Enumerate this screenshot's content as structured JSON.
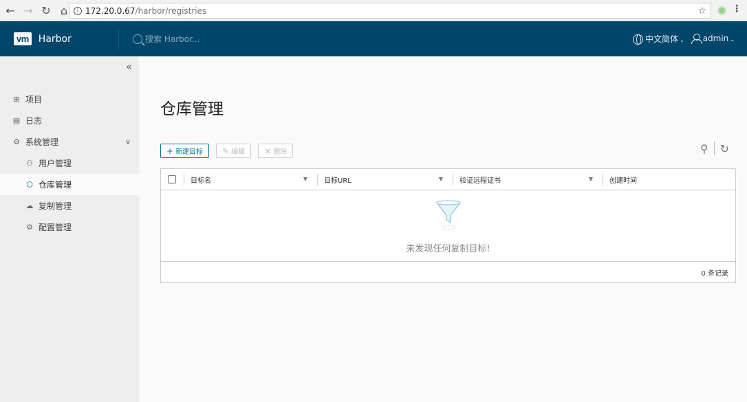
{
  "browser": {
    "url_host": "172.20.0.67",
    "url_path": "/harbor/registries"
  },
  "header": {
    "logo": "vm",
    "brand": "Harbor",
    "search_placeholder": "搜索 Harbor...",
    "language": "中文简体",
    "user": "admin"
  },
  "sidebar": {
    "items": [
      {
        "label": "项目",
        "icon": "projects-icon"
      },
      {
        "label": "日志",
        "icon": "logs-icon"
      },
      {
        "label": "系统管理",
        "icon": "admin-icon"
      }
    ],
    "sub_items": [
      {
        "label": "用户管理",
        "icon": "users-icon"
      },
      {
        "label": "仓库管理",
        "icon": "registry-icon",
        "active": true
      },
      {
        "label": "复制管理",
        "icon": "replication-icon"
      },
      {
        "label": "配置管理",
        "icon": "config-icon"
      }
    ]
  },
  "main": {
    "title": "仓库管理",
    "toolbar": {
      "new": "新建目标",
      "edit": "编辑",
      "delete": "删除"
    },
    "grid": {
      "columns": [
        "目标名",
        "目标URL",
        "验证远程证书",
        "创建时间"
      ],
      "empty_text": "未发现任何复制目标!",
      "footer": "0 条记录"
    }
  },
  "colors": {
    "header_bg": "#00466b",
    "accent": "#0072a3",
    "sidebar_bg": "#eeeeee"
  }
}
